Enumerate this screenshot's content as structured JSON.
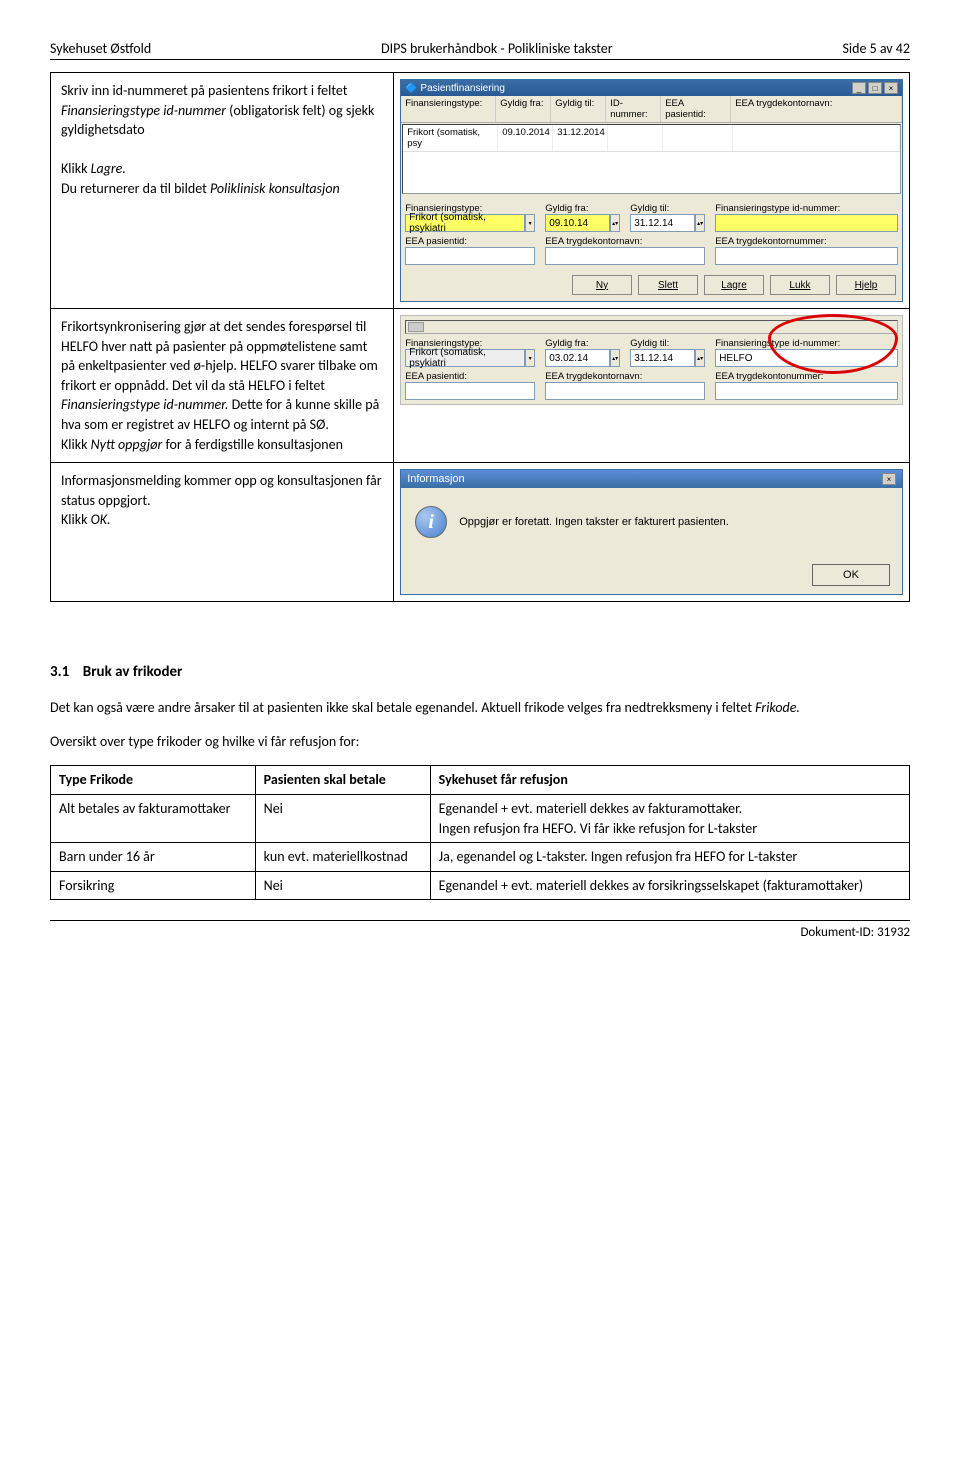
{
  "header": {
    "left": "Sykehuset Østfold",
    "center": "DIPS brukerhåndbok - Polikliniske takster",
    "right": "Side 5 av 42"
  },
  "block1": {
    "text_l1": "Skriv inn id-nummeret på pasientens frikort i feltet ",
    "text_l1_italic": "Finansieringstype id-nummer",
    "text_l1b": " (obligatorisk felt) og sjekk gyldighetsdato",
    "text_l2a": "Klikk ",
    "text_l2_italic": "Lagre.",
    "text_l3a": "Du returnerer da til bildet ",
    "text_l3_italic": "Poliklinisk konsultasjon",
    "win_title": "Pasientfinansiering",
    "grid_headers": [
      "Finansieringstype:",
      "Gyldig fra:",
      "Gyldig til:",
      "ID-nummer:",
      "EEA pasientid:",
      "EEA trygdekontornavn:"
    ],
    "grid_row": [
      "Frikort (somatisk, psy",
      "09.10.2014",
      "31.12.2014",
      "",
      "",
      ""
    ],
    "form": {
      "l1": "Finansieringstype:",
      "v1": "Frikort (somatisk, psykiatri",
      "l2": "Gyldig fra:",
      "v2": "09.10.14",
      "l3": "Gyldig til:",
      "v3": "31.12.14",
      "l4": "Finansieringstype id-nummer:",
      "l5": "EEA pasientid:",
      "l6": "EEA trygdekontornavn:",
      "l7": "EEA trygdekontornummer:"
    },
    "buttons": [
      "Ny",
      "Slett",
      "Lagre",
      "Lukk",
      "Hjelp"
    ]
  },
  "block2": {
    "text_a": "Frikortsynkronisering gjør at det sendes forespørsel til HELFO hver natt på pasienter på oppmøtelistene samt på enkeltpasienter ved ø-hjelp. HELFO svarer tilbake om frikort er oppnådd. Det vil da stå HELFO i feltet ",
    "text_a_italic": "Finansieringstype id-nummer.",
    "text_b": " Dette for å kunne skille på hva som er registret av HELFO og internt på SØ.",
    "text_c1": "Klikk ",
    "text_c_italic": "Nytt oppgjør",
    "text_c2": " for å ferdigstille konsultasjonen",
    "form": {
      "l1": "Finansieringstype:",
      "v1": "Frikort (somatisk, psykiatri",
      "l2": "Gyldig fra:",
      "v2": "03.02.14",
      "l3": "Gyldig til:",
      "v3": "31.12.14",
      "l4": "Finansieringstype id-nummer:",
      "v4": "HELFO",
      "l5": "EEA pasientid:",
      "l6": "EEA trygdekontornavn:",
      "l7": "EEA trygdekontonummer:"
    }
  },
  "block3": {
    "text_a": "Informasjonsmelding kommer opp og konsultasjonen får status oppgjort.",
    "text_b1": "Klikk ",
    "text_b_italic": "OK.",
    "dlg_title": "Informasjon",
    "dlg_msg": "Oppgjør er foretatt. Ingen takster er fakturert pasienten.",
    "dlg_ok": "OK"
  },
  "section": {
    "heading_num": "3.1",
    "heading_txt": "Bruk av frikoder",
    "p1a": "Det kan også være andre årsaker til at pasienten ikke skal betale egenandel. Aktuell frikode velges fra nedtrekksmeny i feltet ",
    "p1_italic": "Frikode.",
    "p2": "Oversikt over type frikoder og hvilke vi får refusjon for:"
  },
  "table": {
    "h1": "Type Frikode",
    "h2": "Pasienten skal betale",
    "h3": "Sykehuset får refusjon",
    "r1c1": "Alt betales av fakturamottaker",
    "r1c2": "Nei",
    "r1c3": "Egenandel + evt. materiell dekkes av fakturamottaker.\nIngen refusjon fra HEFO. Vi får ikke refusjon for L-takster",
    "r2c1": "Barn under 16 år",
    "r2c2": "kun evt. materiellkostnad",
    "r2c3": "Ja, egenandel og L-takster. Ingen refusjon fra HEFO for L-takster",
    "r3c1": "Forsikring",
    "r3c2": "Nei",
    "r3c3": "Egenandel + evt. materiell dekkes av forsikringsselskapet (fakturamottaker)"
  },
  "footer": "Dokument-ID: 31932"
}
